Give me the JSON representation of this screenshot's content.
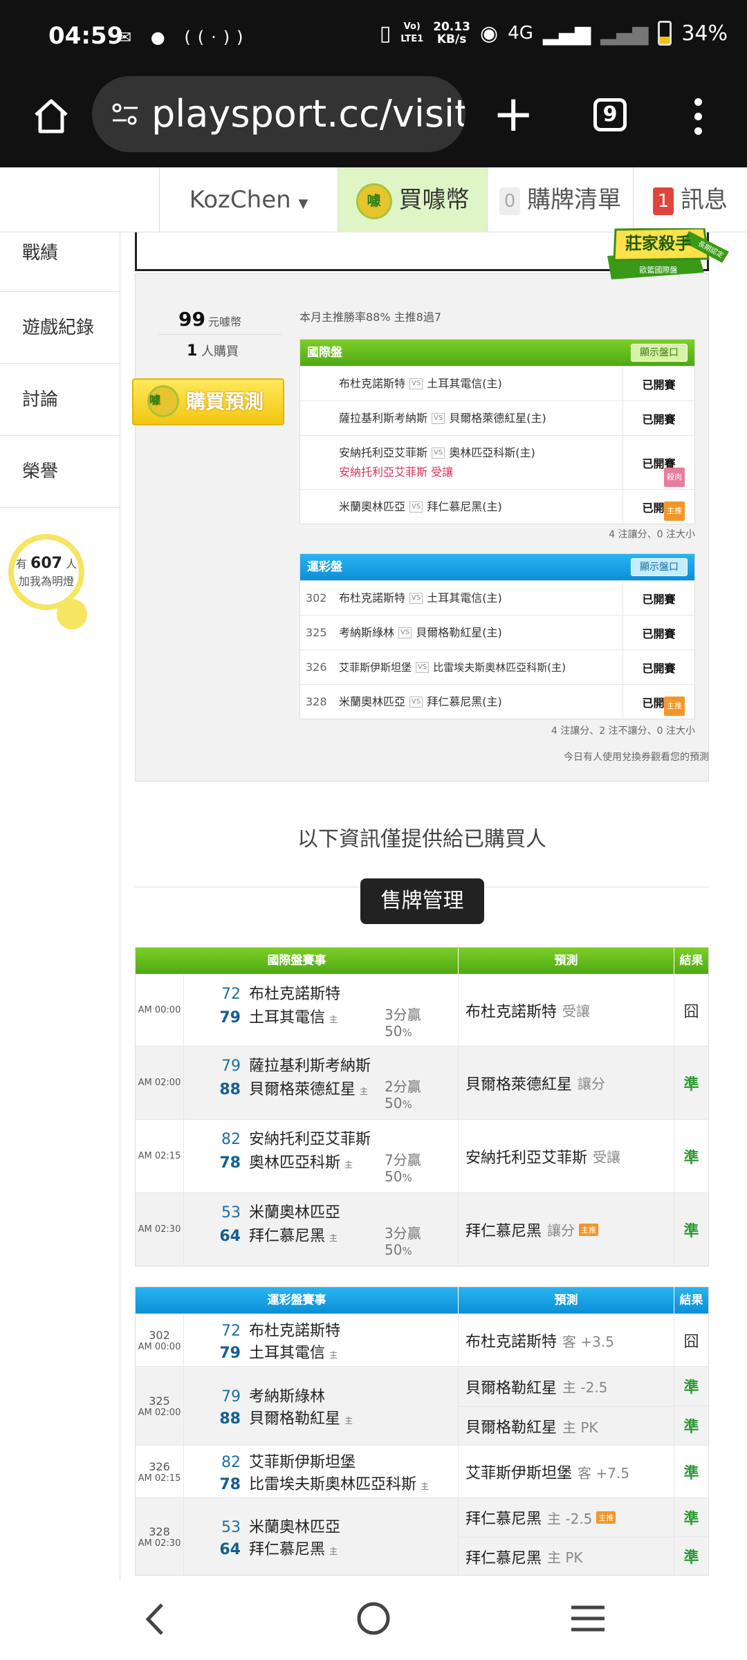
{
  "status": {
    "time": "04:59",
    "rate_top": "20.13",
    "rate_bottom": "KB/s",
    "lte": "Vo)\nLTE1",
    "net": "4G",
    "battery": "34%",
    "battery_level": 0.34
  },
  "browser": {
    "url": "playsport.cc/visit",
    "tab_count": "9"
  },
  "topnav": {
    "user": "KozChen",
    "buy_label": "買噱幣",
    "coin_glyph": "噱",
    "cart_count": "0",
    "cart_label": "購牌清單",
    "msg_count": "1",
    "msg_label": "訊息"
  },
  "sidebar": {
    "items": [
      "戰績",
      "遊戲紀錄",
      "討論",
      "榮譽"
    ],
    "fans_prefix": "有",
    "fans_count": "607",
    "fans_suffix": "人",
    "fans_sub": "加我為明燈"
  },
  "card": {
    "price": "99",
    "price_unit": "元噱幣",
    "buyers": "1",
    "buyers_unit": "人購買",
    "buy_button": "購買預測",
    "stats": "本月主推勝率88% 主推8過7",
    "banner_main": "莊家殺手",
    "banner_sub": "歐籃國際盤",
    "banner_ribbon": "長期認定",
    "intl": {
      "title": "國際盤",
      "show": "顯示盤口",
      "rows": [
        {
          "home": "布杜克諾斯特",
          "away": "土耳其電信(主)",
          "status": "已開賽"
        },
        {
          "home": "薩拉基利斯考納斯",
          "away": "貝爾格萊德紅星(主)",
          "status": "已開賽"
        },
        {
          "home": "安納托利亞艾菲斯",
          "away": "奧林匹亞科斯(主)",
          "pick": "安納托利亞艾菲斯",
          "pick_type": "受讓",
          "tag": "殺肉",
          "status": "已開賽"
        },
        {
          "home": "米蘭奧林匹亞",
          "away": "拜仁慕尼黑(主)",
          "tag": "主推",
          "status": "已開賽"
        }
      ],
      "summary": "4 注讓分、0 注大小"
    },
    "lottery": {
      "title": "運彩盤",
      "show": "顯示盤口",
      "rows": [
        {
          "num": "302",
          "home": "布杜克諾斯特",
          "away": "土耳其電信(主)",
          "status": "已開賽"
        },
        {
          "num": "325",
          "home": "考納斯綠林",
          "away": "貝爾格勒紅星(主)",
          "status": "已開賽"
        },
        {
          "num": "326",
          "home": "艾菲斯伊斯坦堡",
          "away": "比雷埃夫斯奧林匹亞科斯(主)",
          "status": "已開賽"
        },
        {
          "num": "328",
          "home": "米蘭奧林匹亞",
          "away": "拜仁慕尼黑(主)",
          "tag": "主推",
          "status": "已開賽"
        }
      ],
      "summary": "4 注讓分、2 注不讓分、0 注大小"
    },
    "footnote": "今日有人使用兌換券觀看您的預測"
  },
  "info_text": "以下資訊僅提供給已購買人",
  "manage_button": "售牌管理",
  "results_intl": {
    "h1": "國際盤賽事",
    "h2": "預測",
    "h3": "結果",
    "home_mark": "主",
    "rows": [
      {
        "time": "AM 00:00",
        "s1": "72",
        "t1": "布杜克諾斯特",
        "s2": "79",
        "t2": "土耳其電信",
        "spread": "3分贏",
        "pct": "50",
        "pct_unit": "%",
        "pick": "布杜克諾斯特",
        "pt": "受讓",
        "res": "囧",
        "win": false
      },
      {
        "time": "AM 02:00",
        "s1": "79",
        "t1": "薩拉基利斯考納斯",
        "s2": "88",
        "t2": "貝爾格萊德紅星",
        "spread": "2分贏",
        "pct": "50",
        "pct_unit": "%",
        "pick": "貝爾格萊德紅星",
        "pt": "讓分",
        "res": "準",
        "win": true
      },
      {
        "time": "AM 02:15",
        "s1": "82",
        "t1": "安納托利亞艾菲斯",
        "s2": "78",
        "t2": "奧林匹亞科斯",
        "spread": "7分贏",
        "pct": "50",
        "pct_unit": "%",
        "pick": "安納托利亞艾菲斯",
        "pt": "受讓",
        "res": "準",
        "win": true
      },
      {
        "time": "AM 02:30",
        "s1": "53",
        "t1": "米蘭奧林匹亞",
        "s2": "64",
        "t2": "拜仁慕尼黑",
        "spread": "3分贏",
        "pct": "50",
        "pct_unit": "%",
        "pick": "拜仁慕尼黑",
        "pt": "讓分",
        "tag": "主推",
        "res": "準",
        "win": true
      }
    ]
  },
  "results_lottery": {
    "h1": "運彩盤賽事",
    "h2": "預測",
    "h3": "結果",
    "home_mark": "主",
    "rows": [
      {
        "num": "302",
        "time": "AM 00:00",
        "s1": "72",
        "t1": "布杜克諾斯特",
        "s2": "79",
        "t2": "土耳其電信",
        "picks": [
          {
            "team": "布杜克諾斯特",
            "pt": "客 +3.5",
            "res": "囧",
            "win": false
          }
        ]
      },
      {
        "num": "325",
        "time": "AM 02:00",
        "s1": "79",
        "t1": "考納斯綠林",
        "s2": "88",
        "t2": "貝爾格勒紅星",
        "picks": [
          {
            "team": "貝爾格勒紅星",
            "pt": "主 -2.5",
            "res": "準",
            "win": true
          },
          {
            "team": "貝爾格勒紅星",
            "pt": "主 PK",
            "res": "準",
            "win": true
          }
        ]
      },
      {
        "num": "326",
        "time": "AM 02:15",
        "s1": "82",
        "t1": "艾菲斯伊斯坦堡",
        "s2": "78",
        "t2": "比雷埃夫斯奧林匹亞科斯",
        "picks": [
          {
            "team": "艾菲斯伊斯坦堡",
            "pt": "客 +7.5",
            "res": "準",
            "win": true
          }
        ]
      },
      {
        "num": "328",
        "time": "AM 02:30",
        "s1": "53",
        "t1": "米蘭奧林匹亞",
        "s2": "64",
        "t2": "拜仁慕尼黑",
        "picks": [
          {
            "team": "拜仁慕尼黑",
            "pt": "主 -2.5",
            "tag": "主推",
            "res": "準",
            "win": true
          },
          {
            "team": "拜仁慕尼黑",
            "pt": "主 PK",
            "res": "準",
            "win": true
          }
        ]
      }
    ]
  }
}
